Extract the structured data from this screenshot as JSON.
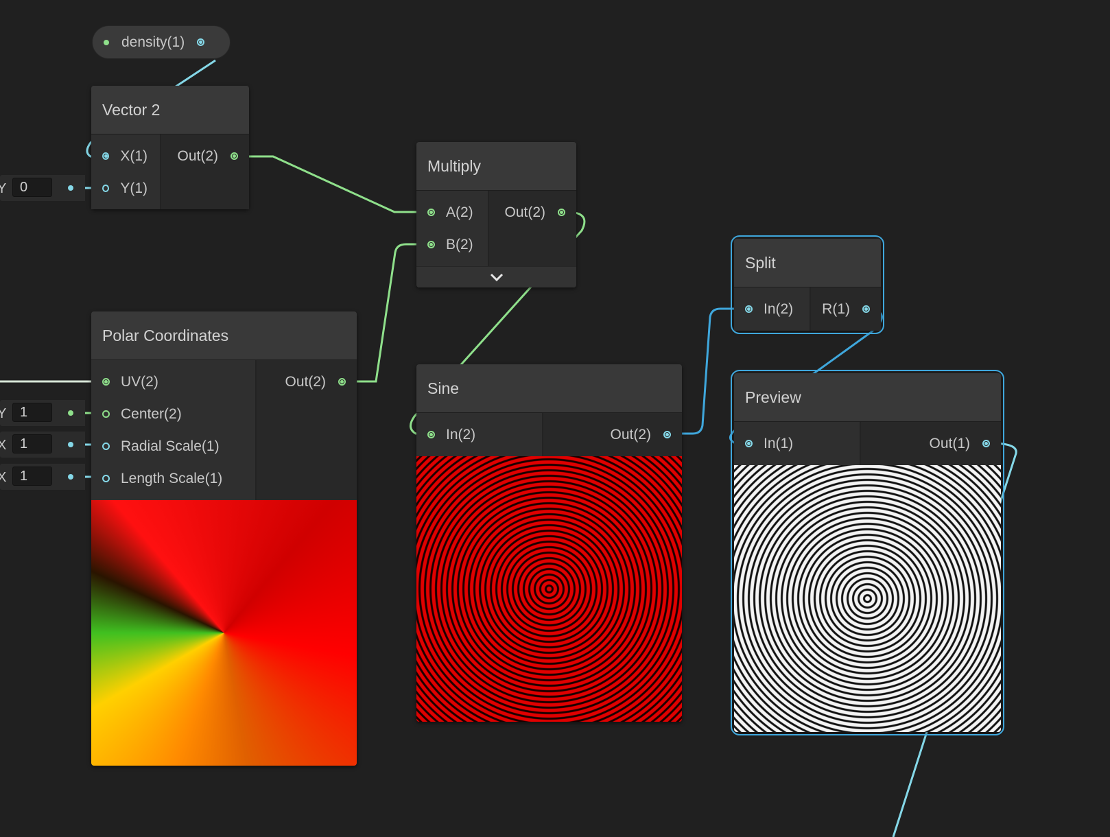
{
  "colors": {
    "background": "#202020",
    "vector2_wire": "#8fe08b",
    "vector1_wire": "#85d8e8",
    "selection": "#3fa7dc"
  },
  "property_pill": {
    "label": "density(1)",
    "port_icon": "cyan-port-icon"
  },
  "nodes": {
    "vector2": {
      "title": "Vector 2",
      "inputs": [
        "X(1)",
        "Y(1)"
      ],
      "outputs": [
        "Out(2)"
      ],
      "y_default": {
        "axis": "Y",
        "value": "0"
      }
    },
    "multiply": {
      "title": "Multiply",
      "inputs": [
        "A(2)",
        "B(2)"
      ],
      "outputs": [
        "Out(2)"
      ],
      "expand_icon": "chevron-down-icon"
    },
    "polar": {
      "title": "Polar Coordinates",
      "inputs": [
        "UV(2)",
        "Center(2)",
        "Radial Scale(1)",
        "Length Scale(1)"
      ],
      "outputs": [
        "Out(2)"
      ],
      "defaults": [
        {
          "axis": "Y",
          "value": "1"
        },
        {
          "axis": "X",
          "value": "1"
        },
        {
          "axis": "X",
          "value": "1"
        }
      ]
    },
    "sine": {
      "title": "Sine",
      "inputs": [
        "In(2)"
      ],
      "outputs": [
        "Out(2)"
      ]
    },
    "split": {
      "title": "Split",
      "inputs": [
        "In(2)"
      ],
      "outputs": [
        "R(1)"
      ]
    },
    "preview": {
      "title": "Preview",
      "inputs": [
        "In(1)"
      ],
      "outputs": [
        "Out(1)"
      ]
    }
  }
}
